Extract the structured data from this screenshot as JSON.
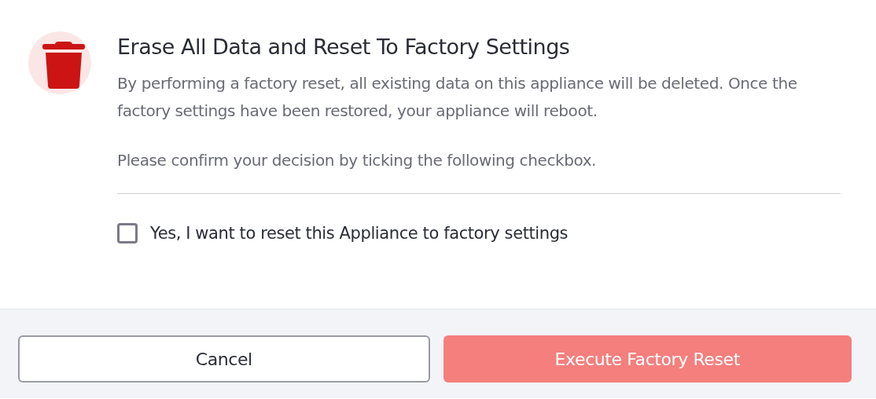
{
  "dialog": {
    "title": "Erase All Data and Reset To Factory Settings",
    "paragraphs": [
      "By performing a factory reset, all existing data on this appliance will be deleted. Once the factory settings have been restored, your appliance will reboot.",
      "Please confirm your decision by ticking the following checkbox."
    ],
    "checkbox": {
      "label": "Yes, I want to reset this Appliance to factory settings",
      "checked": false
    },
    "buttons": [
      {
        "label": "Cancel",
        "kind": "secondary",
        "disabled": false
      },
      {
        "label": "Execute Factory Reset",
        "kind": "danger",
        "disabled": true
      }
    ]
  }
}
